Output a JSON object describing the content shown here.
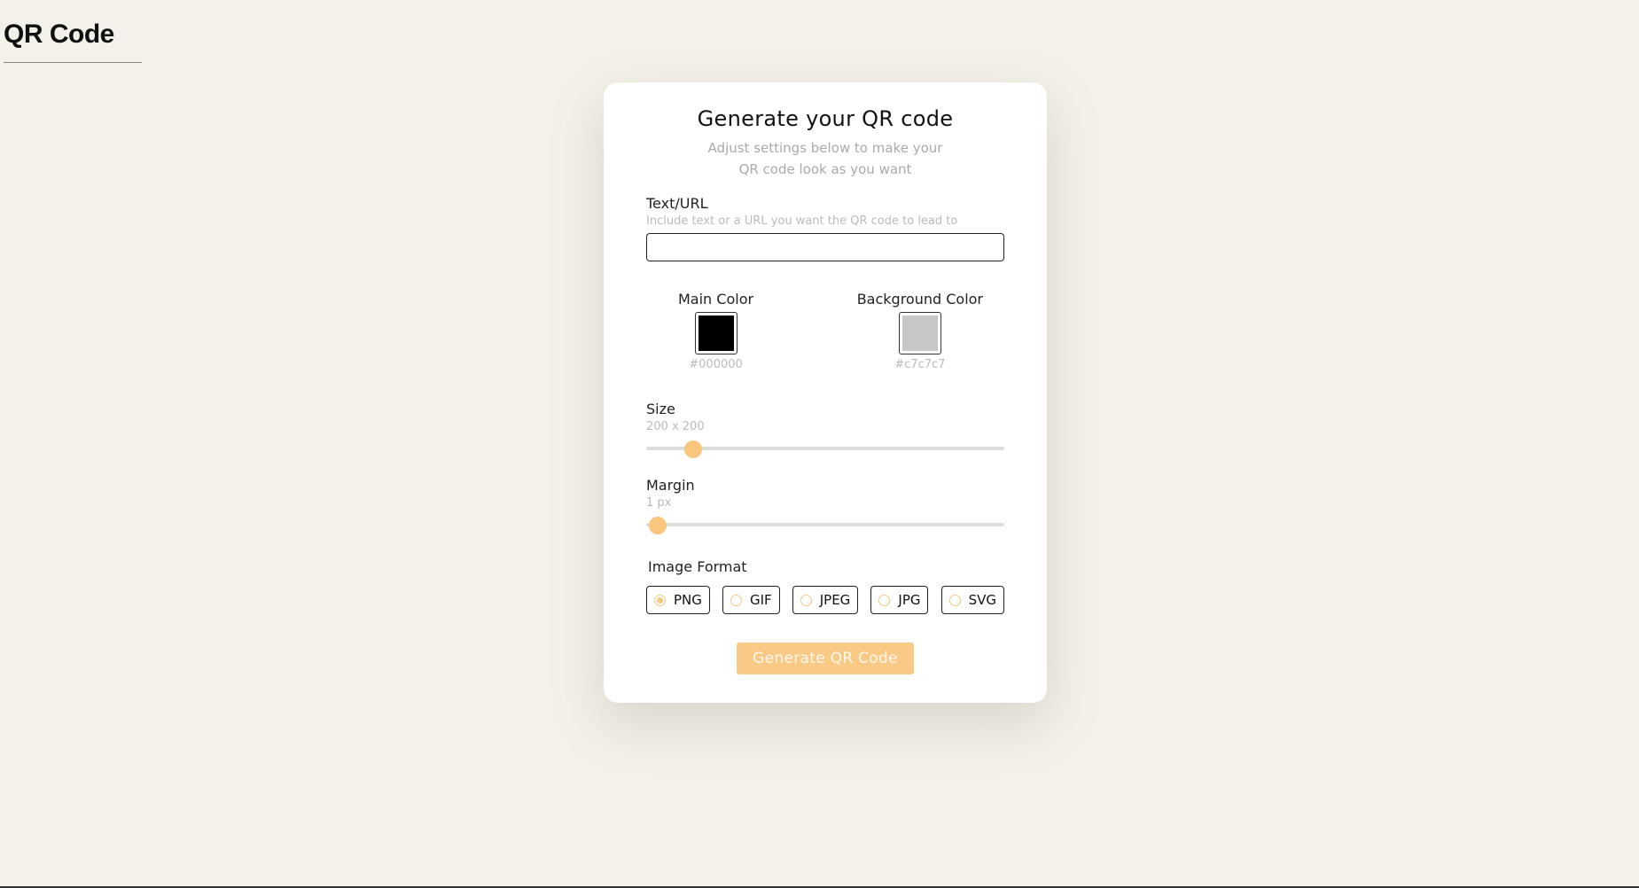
{
  "header": {
    "title": "QR Code"
  },
  "card": {
    "title": "Generate your QR code",
    "subtitle": "Adjust settings below to make your QR code look as you want"
  },
  "text_url": {
    "label": "Text/URL",
    "hint": "Include text or a URL you want the QR code to lead to",
    "value": ""
  },
  "colors": {
    "main": {
      "label": "Main Color",
      "value": "#000000",
      "hex_label": "#000000"
    },
    "background": {
      "label": "Background Color",
      "value": "#c7c7c7",
      "hex_label": "#c7c7c7"
    }
  },
  "size": {
    "label": "Size",
    "value_label": "200 x 200",
    "value": 200,
    "fraction": 0.13
  },
  "margin": {
    "label": "Margin",
    "value_label": "1 px",
    "value": 1,
    "fraction": 0.033
  },
  "image_format": {
    "label": "Image Format",
    "selected": "PNG",
    "options": [
      "PNG",
      "GIF",
      "JPEG",
      "JPG",
      "SVG"
    ]
  },
  "generate_button": {
    "label": "Generate QR Code"
  },
  "theme": {
    "accent": "#fac57c",
    "page_background": "#f4f1ea"
  }
}
